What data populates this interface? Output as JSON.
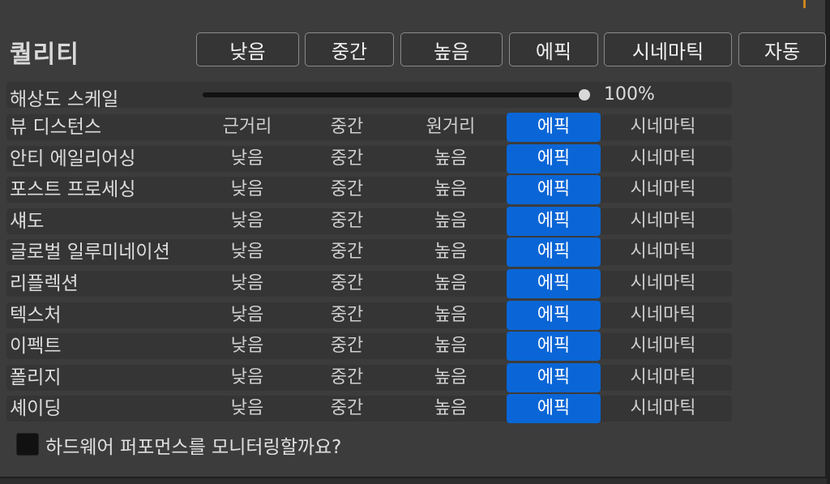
{
  "quality": {
    "title": "퀄리티",
    "presets": [
      {
        "label": "낮음"
      },
      {
        "label": "중간"
      },
      {
        "label": "높음"
      },
      {
        "label": "에픽"
      },
      {
        "label": "시네마틱"
      },
      {
        "label": "자동"
      }
    ]
  },
  "resolution": {
    "label": "해상도 스케일",
    "value_text": "100%",
    "value_fraction": 1.0
  },
  "settings": [
    {
      "label": "뷰 디스턴스",
      "options": [
        "근거리",
        "중간",
        "원거리",
        "에픽",
        "시네마틱"
      ],
      "selected": 3
    },
    {
      "label": "안티 에일리어싱",
      "options": [
        "낮음",
        "중간",
        "높음",
        "에픽",
        "시네마틱"
      ],
      "selected": 3
    },
    {
      "label": "포스트 프로세싱",
      "options": [
        "낮음",
        "중간",
        "높음",
        "에픽",
        "시네마틱"
      ],
      "selected": 3
    },
    {
      "label": "섀도",
      "options": [
        "낮음",
        "중간",
        "높음",
        "에픽",
        "시네마틱"
      ],
      "selected": 3
    },
    {
      "label": "글로벌 일루미네이션",
      "options": [
        "낮음",
        "중간",
        "높음",
        "에픽",
        "시네마틱"
      ],
      "selected": 3
    },
    {
      "label": "리플렉션",
      "options": [
        "낮음",
        "중간",
        "높음",
        "에픽",
        "시네마틱"
      ],
      "selected": 3
    },
    {
      "label": "텍스처",
      "options": [
        "낮음",
        "중간",
        "높음",
        "에픽",
        "시네마틱"
      ],
      "selected": 3
    },
    {
      "label": "이펙트",
      "options": [
        "낮음",
        "중간",
        "높음",
        "에픽",
        "시네마틱"
      ],
      "selected": 3
    },
    {
      "label": "폴리지",
      "options": [
        "낮음",
        "중간",
        "높음",
        "에픽",
        "시네마틱"
      ],
      "selected": 3
    },
    {
      "label": "셰이딩",
      "options": [
        "낮음",
        "중간",
        "높음",
        "에픽",
        "시네마틱"
      ],
      "selected": 3
    }
  ],
  "hardware_monitor": {
    "label": "하드웨어 퍼포먼스를 모니터링할까요?",
    "checked": false
  },
  "colors": {
    "selected": "#0a66d6",
    "panel": "#3c3c3c",
    "row": "#353535"
  }
}
